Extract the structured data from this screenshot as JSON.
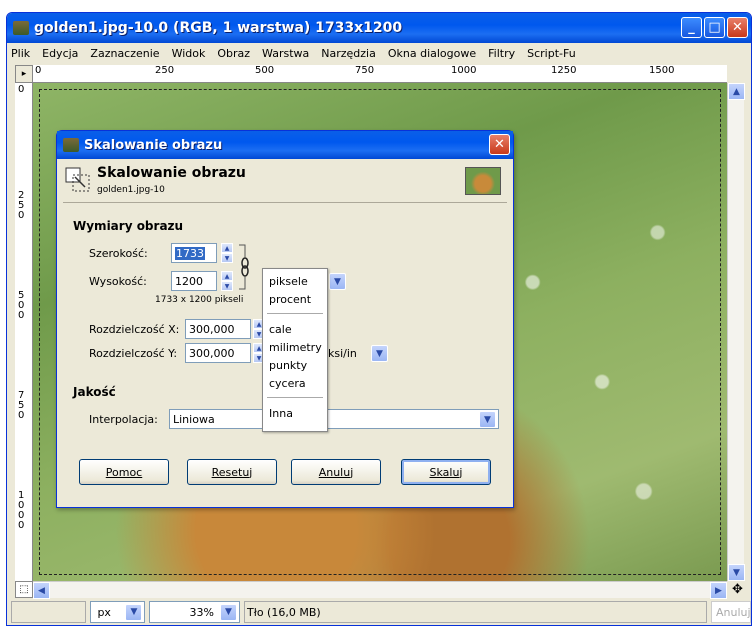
{
  "window": {
    "title": "golden1.jpg-10.0 (RGB, 1 warstwa) 1733x1200"
  },
  "menu": [
    "Plik",
    "Edycja",
    "Zaznaczenie",
    "Widok",
    "Obraz",
    "Warstwa",
    "Narzędzia",
    "Okna dialogowe",
    "Filtry",
    "Script-Fu"
  ],
  "ruler": {
    "top": [
      "0",
      "250",
      "500",
      "750",
      "1000",
      "1250",
      "1500"
    ],
    "left": [
      "0",
      "2 5 0",
      "5 0 0",
      "7 5 0",
      "1 0 0 0"
    ]
  },
  "status": {
    "unit": "px",
    "zoom": "33%",
    "layer_info": "Tło (16,0 MB)",
    "cancel": "Anuluj"
  },
  "dialog": {
    "title": "Skalowanie obrazu",
    "header": "Skalowanie obrazu",
    "subheader": "golden1.jpg-10",
    "dims_label": "Wymiary obrazu",
    "width_label": "Szerokość:",
    "width_value": "1733",
    "height_label": "Wysokość:",
    "height_value": "1200",
    "size_hint": "1733 x 1200 pikseli",
    "resx_label": "Rozdzielczość X:",
    "resx_value": "300,000",
    "resy_label": "Rozdzielczość Y:",
    "resy_value": "300,000",
    "res_unit": "ksi/in",
    "quality_label": "Jakość",
    "interp_label": "Interpolacja:",
    "interp_value": "Liniowa",
    "buttons": {
      "help": "Pomoc",
      "reset": "Resetuj",
      "cancel": "Anuluj",
      "scale": "Skaluj"
    }
  },
  "unit_menu": [
    "piksele",
    "procent",
    "cale",
    "milimetry",
    "punkty",
    "cycera",
    "Inna"
  ],
  "colors": {
    "titlebar": "#0058ee",
    "selection": "#316ac5",
    "dialog_bg": "#ece9d8"
  }
}
